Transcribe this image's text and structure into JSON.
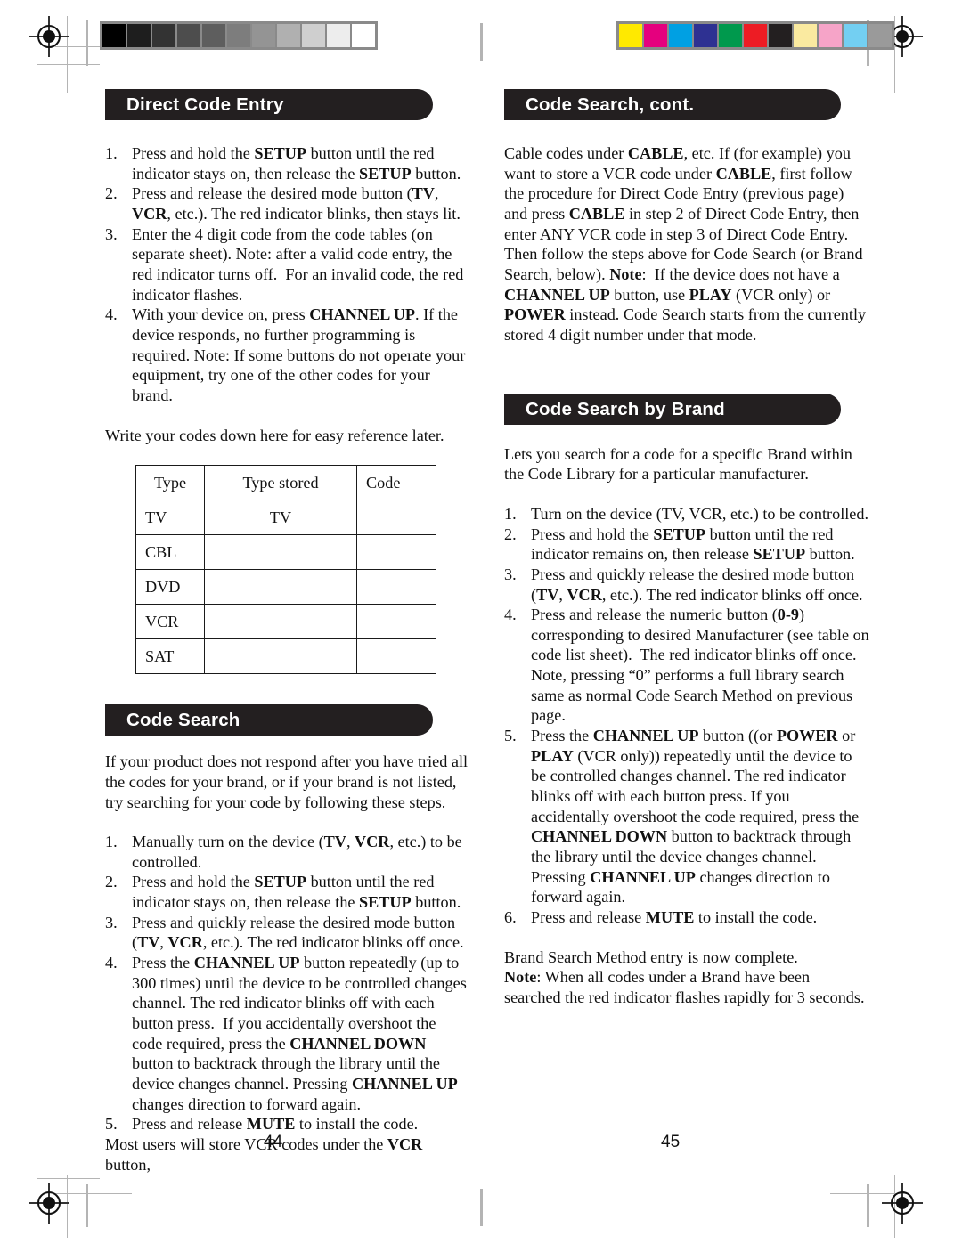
{
  "document": {
    "type": "printed-manual-spread",
    "left_page_number": "44",
    "right_page_number": "45"
  },
  "calibration": {
    "grayscale_strip": {
      "name": "grayscale-step-wedge",
      "patches": [
        "#000000",
        "#1e1e1e",
        "#333333",
        "#4d4d4d",
        "#5e5e5e",
        "#7d7d7d",
        "#949494",
        "#b0b0b0",
        "#cfcfcf",
        "#ededed",
        "#ffffff"
      ]
    },
    "color_strip": {
      "name": "process-color-bar",
      "patches": [
        "#ffe900",
        "#e5007e",
        "#00a0e3",
        "#2e3192",
        "#00994d",
        "#ed1c24",
        "#231f20",
        "#faeaa0",
        "#f6a4c8",
        "#73cff2",
        "#9a9a9a"
      ]
    }
  },
  "left_column": {
    "section1": {
      "banner": "Direct Code Entry",
      "steps": [
        {
          "num": "1.",
          "html": "Press and hold the <b>SETUP</b> button until the red indicator stays on, then release the <b>SETUP</b> button."
        },
        {
          "num": "2.",
          "html": "Press and release the desired mode button (<b>TV</b>, <b>VCR</b>, etc.). The red indicator blinks, then stays lit."
        },
        {
          "num": "3.",
          "html": "Enter the 4 digit code from the code tables (on separate sheet). Note: after a valid code entry, the red indicator turns off.&nbsp; For an invalid code, the red indicator flashes."
        },
        {
          "num": "4.",
          "html": "With your device on, press <b>CHANNEL UP</b>. If the device responds, no further programming is required. Note: If some buttons do not operate your equipment, try one of the other codes for your brand."
        }
      ],
      "note": "Write your codes down here for easy reference later.",
      "table": {
        "headers": [
          "Type",
          "Type stored",
          "Code"
        ],
        "rows": [
          {
            "type": "TV",
            "stored": "TV",
            "code": ""
          },
          {
            "type": "CBL",
            "stored": "",
            "code": ""
          },
          {
            "type": "DVD",
            "stored": "",
            "code": ""
          },
          {
            "type": "VCR",
            "stored": "",
            "code": ""
          },
          {
            "type": "SAT",
            "stored": "",
            "code": ""
          }
        ]
      }
    },
    "section2": {
      "banner": "Code Search",
      "intro": "If your product does not respond after you have tried all the codes for your brand, or if your brand is not listed, try searching for your code by following these steps.",
      "steps": [
        {
          "num": "1.",
          "html": "Manually turn on the device (<b>TV</b>, <b>VCR</b>, etc.) to be controlled."
        },
        {
          "num": "2.",
          "html": "Press and hold the <b>SETUP</b> button until the red indicator stays on, then release the <b>SETUP</b> button."
        },
        {
          "num": "3.",
          "html": "Press and quickly release the desired mode button (<b>TV</b>, <b>VCR</b>, etc.). The red indicator blinks off once."
        },
        {
          "num": "4.",
          "html": "Press the <b>CHANNEL UP</b> button repeatedly (up to 300 times) until the device to be controlled changes channel. The red indicator blinks off with each button press.&nbsp; If you accidentally overshoot the code required, press the <b>CHANNEL DOWN</b> button to backtrack through the library until the device changes channel. Pressing <b>CHANNEL UP</b> changes direction to forward again."
        },
        {
          "num": "5.",
          "html": "Press and release <b>MUTE</b> to install the code."
        }
      ],
      "continuation": "Most users will store VCR codes under the <b>VCR</b> button,"
    }
  },
  "right_column": {
    "section1": {
      "banner": "Code Search, cont.",
      "body": "Cable codes under <b>CABLE</b>, etc. If (for example) you want to store a VCR code under <b>CABLE</b>, first follow the procedure for Direct Code Entry (previous page) and press <b>CABLE</b> in step 2 of Direct Code Entry, then enter ANY VCR code in step 3 of Direct Code Entry. Then follow the steps above for Code Search (or Brand Search, below). <b>Note</b>:&nbsp; If the device does not have a <b>CHANNEL UP</b> button, use <b>PLAY</b> (VCR only) or <b>POWER</b> instead. Code Search starts from the currently stored 4 digit number under that mode."
    },
    "section2": {
      "banner": "Code Search by Brand",
      "intro": "Lets you search for a code for a specific Brand within the Code Library for a particular manufacturer.",
      "steps": [
        {
          "num": "1.",
          "html": "Turn on the device (TV, VCR, etc.) to be controlled."
        },
        {
          "num": "2.",
          "html": "Press and hold the <b>SETUP</b> button until the red indicator remains on, then release <b>SETUP</b> button."
        },
        {
          "num": "3.",
          "html": "Press and quickly release the desired mode button (<b>TV</b>, <b>VCR</b>, etc.). The red indicator blinks off once."
        },
        {
          "num": "4.",
          "html": "Press and release the numeric button (<b>0-9</b>) corresponding to desired Manufacturer (see table on code list sheet).&nbsp; The red indicator blinks off once. Note, pressing &ldquo;0&rdquo; performs a full library search same as normal Code Search Method on previous page."
        },
        {
          "num": "5.",
          "html": "Press the <b>CHANNEL UP</b> button ((or <b>POWER</b> or <b>PLAY</b> (VCR only)) repeatedly until the device to be controlled changes channel. The red indicator blinks off with each button press. If you accidentally overshoot the code required, press the <b>CHANNEL DOWN</b> button to backtrack through the library until the device changes channel. Pressing <b>CHANNEL UP</b> changes direction to forward again."
        },
        {
          "num": "6.",
          "html": "Press and release <b>MUTE</b> to install the code."
        }
      ],
      "closing1": "Brand Search Method entry is now complete.",
      "closing2": "<b>Note</b>: When all codes under a Brand have been searched the red indicator flashes rapidly for 3 seconds."
    }
  }
}
